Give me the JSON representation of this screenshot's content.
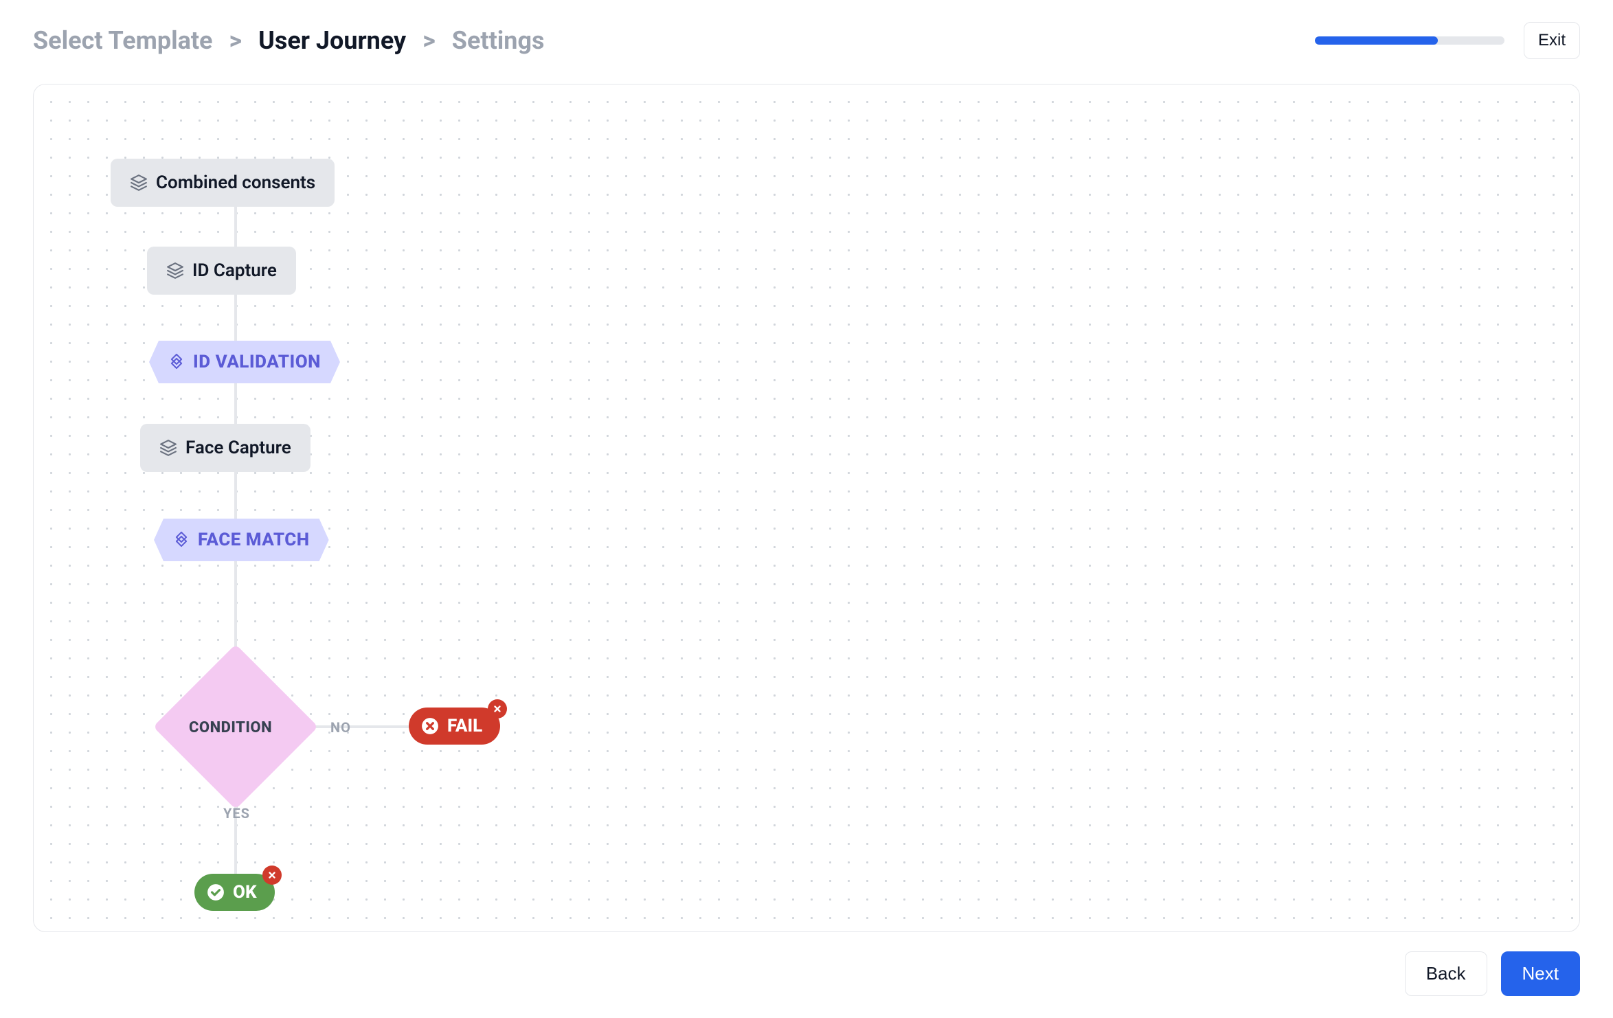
{
  "breadcrumb": {
    "steps": [
      "Select Template",
      "User Journey",
      "Settings"
    ],
    "activeIndex": 1,
    "separator": ">"
  },
  "progress": {
    "percent": 65
  },
  "actions": {
    "exit": "Exit",
    "back": "Back",
    "next": "Next"
  },
  "flow": {
    "combinedConsents": "Combined consents",
    "idCapture": "ID Capture",
    "idValidation": "ID VALIDATION",
    "faceCapture": "Face Capture",
    "faceMatch": "FACE MATCH",
    "condition": "CONDITION",
    "branchNo": "NO",
    "branchYes": "YES",
    "fail": "FAIL",
    "ok": "OK"
  }
}
